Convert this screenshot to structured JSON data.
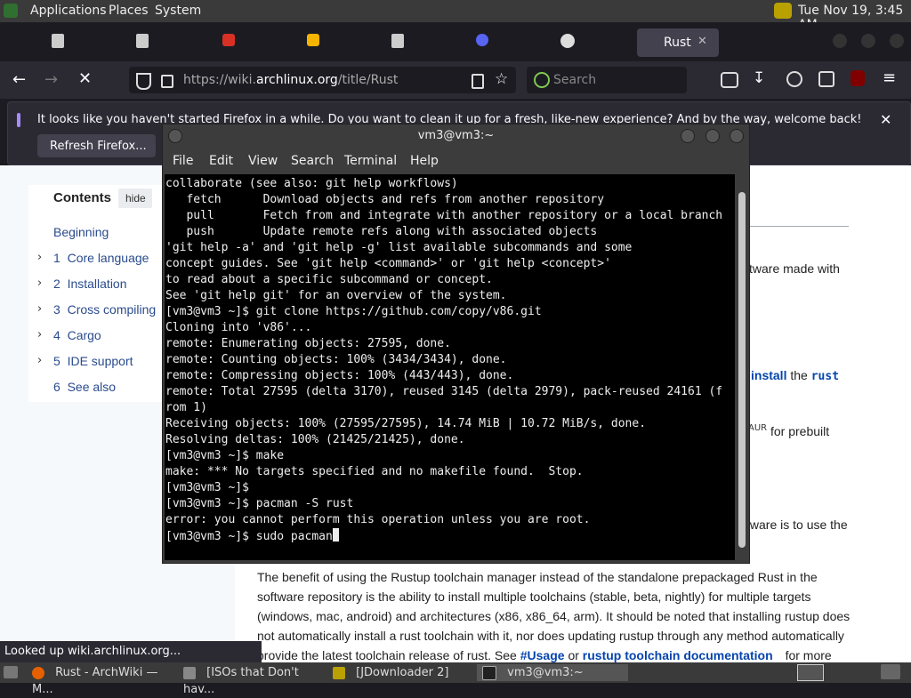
{
  "top_panel": {
    "menus": [
      "Applications",
      "Places",
      "System"
    ],
    "datetime": "Tue Nov 19, 3:45 AM"
  },
  "tabs": {
    "active_label": "Rust",
    "close_glyph": "✕"
  },
  "navbar": {
    "url_prefix": "https://wiki.",
    "url_domain": "archlinux.org",
    "url_path": "/title/Rust",
    "search_placeholder": "Search"
  },
  "notification": {
    "message": "It looks like you haven't started Firefox in a while. Do you want to clean it up for a fresh, like-new experience? And by the way, welcome back!",
    "refresh_button": "Refresh Firefox...",
    "close_glyph": "✕"
  },
  "wiki": {
    "toc_title": "Contents",
    "toc_hide": "hide",
    "toc_items": [
      {
        "num": "",
        "label": "Beginning"
      },
      {
        "num": "1",
        "label": "Core language"
      },
      {
        "num": "2",
        "label": "Installation"
      },
      {
        "num": "3",
        "label": "Cross compiling"
      },
      {
        "num": "4",
        "label": "Cargo"
      },
      {
        "num": "5",
        "label": "IDE support"
      },
      {
        "num": "6",
        "label": "See also"
      }
    ],
    "frag_software_made_with": "tware made with",
    "frag_install": "install",
    "frag_the": "the",
    "frag_rust": "rust",
    "frag_aur": "AUR",
    "frag_for_prebuilt": "for prebuilt",
    "frag_is_to_use": "tware is to use the",
    "paragraph": [
      "The benefit of using the Rustup toolchain manager instead of the standalone prepackaged Rust in the",
      "software repository is the ability to install multiple toolchains (stable, beta, nightly) for multiple targets",
      "(windows, mac, android) and architectures (x86, x86_64, arm). It should be noted that installing rustup does",
      "not automatically install a rust toolchain with it, nor does updating rustup through any method automatically",
      "provide the latest toolchain release of rust. See"
    ],
    "link_usage": "#Usage",
    "word_or": "or",
    "link_rustup_docs": "rustup toolchain documentation",
    "for_more": "for more"
  },
  "terminal": {
    "title": "vm3@vm3:~",
    "menu": [
      "File",
      "Edit",
      "View",
      "Search",
      "Terminal",
      "Help"
    ],
    "lines": [
      "collaborate (see also: git help workflows)",
      "   fetch      Download objects and refs from another repository",
      "   pull       Fetch from and integrate with another repository or a local branch",
      "   push       Update remote refs along with associated objects",
      "",
      "'git help -a' and 'git help -g' list available subcommands and some",
      "concept guides. See 'git help <command>' or 'git help <concept>'",
      "to read about a specific subcommand or concept.",
      "See 'git help git' for an overview of the system.",
      "[vm3@vm3 ~]$ git clone https://github.com/copy/v86.git",
      "Cloning into 'v86'...",
      "remote: Enumerating objects: 27595, done.",
      "remote: Counting objects: 100% (3434/3434), done.",
      "remote: Compressing objects: 100% (443/443), done.",
      "remote: Total 27595 (delta 3170), reused 3145 (delta 2979), pack-reused 24161 (f",
      "rom 1)",
      "Receiving objects: 100% (27595/27595), 14.74 MiB | 10.72 MiB/s, done.",
      "Resolving deltas: 100% (21425/21425), done.",
      "[vm3@vm3 ~]$ make",
      "make: *** No targets specified and no makefile found.  Stop.",
      "[vm3@vm3 ~]$",
      "[vm3@vm3 ~]$ pacman -S rust",
      "error: you cannot perform this operation unless you are root.",
      "[vm3@vm3 ~]$ sudo pacman"
    ]
  },
  "status_text": "Looked up wiki.archlinux.org...",
  "taskbar": {
    "items": [
      "Rust - ArchWiki — M...",
      "[ISOs that Don't hav...",
      "[JDownloader 2]",
      "vm3@vm3:~"
    ]
  }
}
